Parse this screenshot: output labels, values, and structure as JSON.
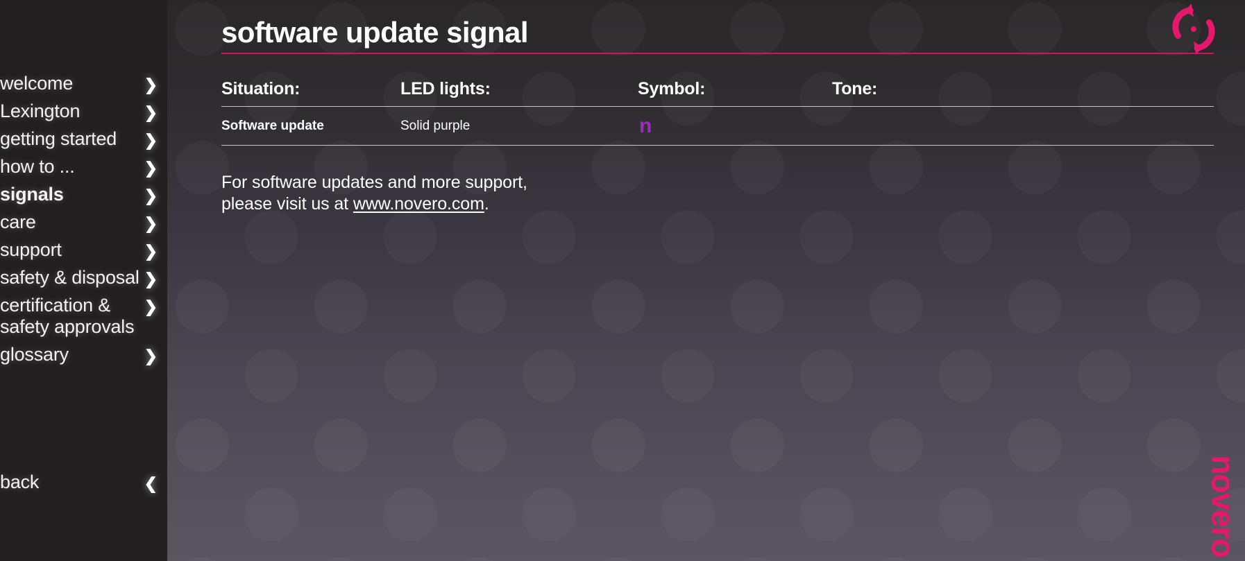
{
  "sidebar": {
    "items": [
      {
        "label": "welcome",
        "icon": "chevron-right-icon",
        "active": false
      },
      {
        "label": "Lexington",
        "icon": "chevron-right-icon",
        "active": false
      },
      {
        "label": "getting started",
        "icon": "chevron-right-icon",
        "active": false
      },
      {
        "label": "how to ...",
        "icon": "chevron-right-icon",
        "active": false
      },
      {
        "label": "signals",
        "icon": "chevron-right-icon",
        "active": true
      },
      {
        "label": "care",
        "icon": "chevron-right-icon",
        "active": false
      },
      {
        "label": "support",
        "icon": "chevron-right-icon",
        "active": false
      },
      {
        "label": "safety & disposal",
        "icon": "chevron-right-icon",
        "active": false
      },
      {
        "label": "certification &\nsafety approvals",
        "icon": "chevron-right-icon",
        "active": false
      },
      {
        "label": "glossary",
        "icon": "chevron-right-icon",
        "active": false
      }
    ],
    "back": {
      "label": "back",
      "icon": "chevron-left-icon"
    },
    "chevron_right": "❯",
    "chevron_left": "❮"
  },
  "header": {
    "title": "software update signal",
    "accent_color": "#d4145a",
    "update_icon": "refresh-sync-icon"
  },
  "table": {
    "columns": [
      "Situation:",
      "LED lights:",
      "Symbol:",
      "Tone:"
    ],
    "rows": [
      {
        "situation": "Software update",
        "led_lights": "Solid purple",
        "symbol": "n",
        "symbol_color": "#9B2BC4",
        "tone": ""
      }
    ]
  },
  "support_note": {
    "line1": "For software updates and more support,",
    "line2_prefix": "please visit us at ",
    "url": "www.novero.com",
    "line2_suffix": "."
  },
  "brand": {
    "name": "novero",
    "color": "#e6186c"
  }
}
